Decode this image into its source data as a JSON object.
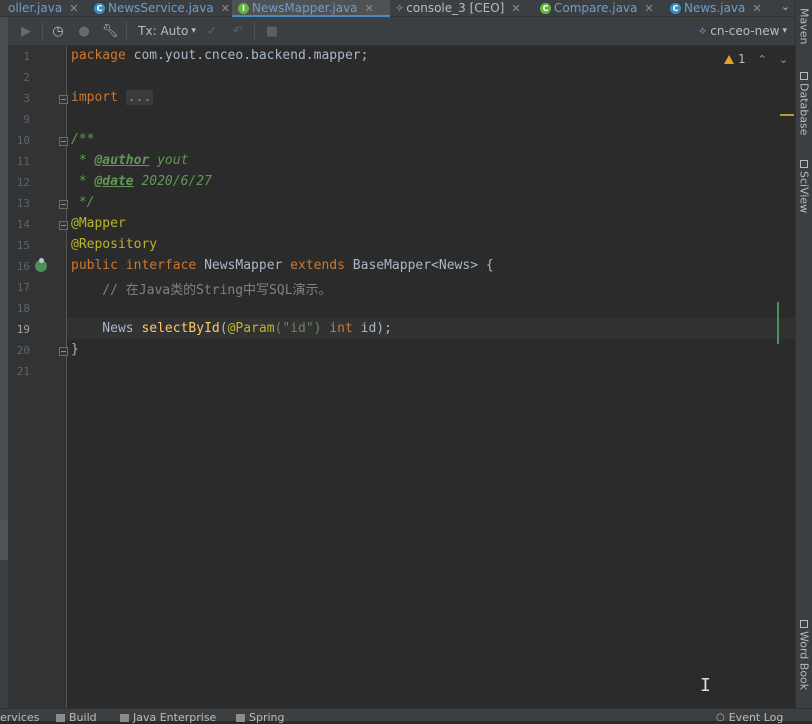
{
  "tabs": [
    {
      "label": "oller.java",
      "icon": "class-icon"
    },
    {
      "label": "NewsService.java",
      "icon": "class-icon"
    },
    {
      "label": "NewsMapper.java",
      "icon": "interface-icon",
      "active": true
    },
    {
      "label": "console_3 [CEO]",
      "icon": "console-icon"
    },
    {
      "label": "Compare.java",
      "icon": "class-icon"
    },
    {
      "label": "News.java",
      "icon": "class-icon"
    }
  ],
  "toolbar": {
    "tx_label": "Tx: Auto",
    "schema": "cn-ceo-new"
  },
  "editor": {
    "warning_count": "1",
    "line_numbers": [
      "1",
      "2",
      "3",
      "9",
      "10",
      "11",
      "12",
      "13",
      "14",
      "15",
      "16",
      "17",
      "18",
      "19",
      "20",
      "21"
    ],
    "current_line": "19",
    "code": {
      "l1_kw": "package",
      "l1_rest": " com.yout.cnceo.backend.mapper;",
      "l3_kw": "import",
      "l3_fold": "...",
      "l10": "/**",
      "l11_prefix": " * ",
      "l11_tag": "@author",
      "l11_val": " yout",
      "l12_prefix": " * ",
      "l12_tag": "@date",
      "l12_val": " 2020/6/27",
      "l13": " */",
      "l14": "@Mapper",
      "l15": "@Repository",
      "l16_public": "public",
      "l16_interface": " interface",
      "l16_name": " NewsMapper",
      "l16_extends": " extends",
      "l16_rest": " BaseMapper<News> {",
      "l17": "    // 在Java类的String中写SQL演示。",
      "l19_type": "    News ",
      "l19_method": "selectById",
      "l19_open": "(",
      "l19_ann": "@Param",
      "l19_str": "(\"id\")",
      "l19_int": " int",
      "l19_rest": " id);",
      "l20": "}"
    }
  },
  "right_tools": [
    "Maven",
    "Database",
    "SciView",
    "Word Book"
  ],
  "bottom_tools": [
    "ervices",
    "Build",
    "Java Enterprise",
    "Spring",
    "Event Log"
  ]
}
